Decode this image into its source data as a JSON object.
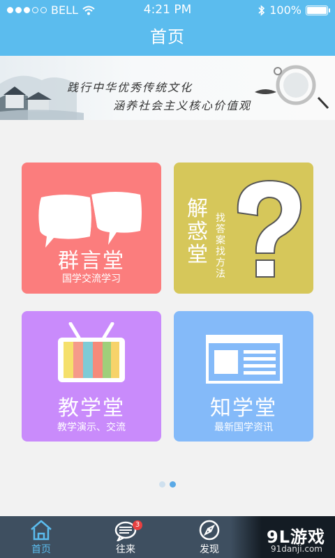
{
  "status_bar": {
    "carrier": "BELL",
    "time": "4:21 PM",
    "battery": "100%",
    "battery_level": 1.0
  },
  "nav": {
    "title": "首页"
  },
  "banner": {
    "line1": "践行中华优秀传统文化",
    "line2": "涵养社会主义核心价值观"
  },
  "tiles": [
    {
      "title": "群言堂",
      "subtitle": "国学交流学习",
      "color": "#fb7d7d",
      "icon": "chat-bubbles-icon"
    },
    {
      "title": "解惑堂",
      "subtitle": "找答案找方法",
      "color": "#d6c75a",
      "icon": "question-mark-icon"
    },
    {
      "title": "教学堂",
      "subtitle": "教学演示、交流",
      "color": "#c98bfb",
      "icon": "tv-icon"
    },
    {
      "title": "知学堂",
      "subtitle": "最新国学资讯",
      "color": "#84baf9",
      "icon": "news-icon"
    }
  ],
  "pager": {
    "pages": 2,
    "current": 2
  },
  "tab_bar": {
    "items": [
      {
        "label": "首页",
        "icon": "home-icon",
        "active": true
      },
      {
        "label": "往来",
        "icon": "message-icon",
        "badge": "3"
      },
      {
        "label": "发现",
        "icon": "discover-icon"
      }
    ]
  },
  "watermark": {
    "main": "9L游戏",
    "sub": "91danji.com"
  },
  "colors": {
    "primary": "#5bbcee",
    "tab_bg": "#3e4f60"
  }
}
